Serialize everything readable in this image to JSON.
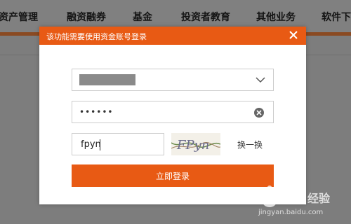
{
  "nav": {
    "items": [
      "资产管理",
      "融资融券",
      "基金",
      "投资者教育",
      "其他业务",
      "软件下"
    ]
  },
  "dialog": {
    "title": "该功能需要使用资金账号登录",
    "password_value": "••••••",
    "captcha_input_value": "fpyn",
    "captcha_image_text": "FPyn",
    "refresh_label": "换一换",
    "login_label": "立即登录"
  },
  "watermark": {
    "text": "Bai 经验",
    "domain": "jingyan.baidu.com"
  },
  "colors": {
    "accent": "#e85a14",
    "overlay": "#7f7f7f"
  }
}
